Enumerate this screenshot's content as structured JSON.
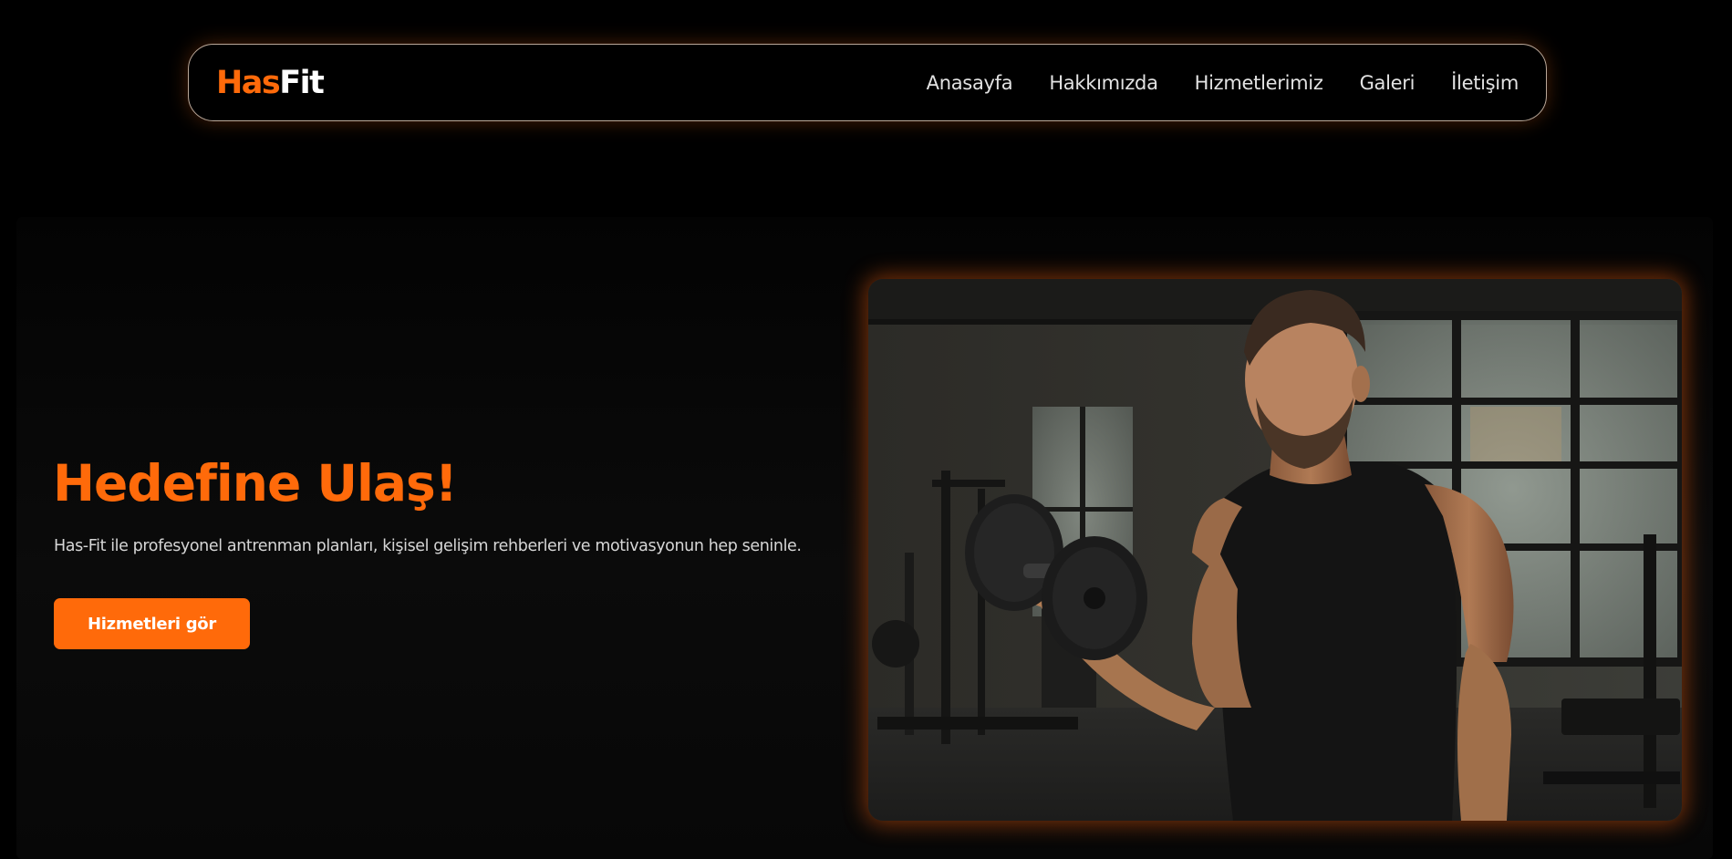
{
  "brand": {
    "logo_part1": "Has",
    "logo_part2": "Fit",
    "accent_color": "#ff6a0a"
  },
  "nav": {
    "items": [
      {
        "label": "Anasayfa"
      },
      {
        "label": "Hakkımızda"
      },
      {
        "label": "Hizmetlerimiz"
      },
      {
        "label": "Galeri"
      },
      {
        "label": "İletişim"
      }
    ]
  },
  "hero": {
    "title": "Hedefine Ulaş!",
    "description": "Has-Fit ile profesyonel antrenman planları, kişisel gelişim rehberleri ve motivasyonun hep seninle.",
    "cta_label": "Hizmetleri gör",
    "image_icon": "gym-man-dumbbell-photo"
  }
}
